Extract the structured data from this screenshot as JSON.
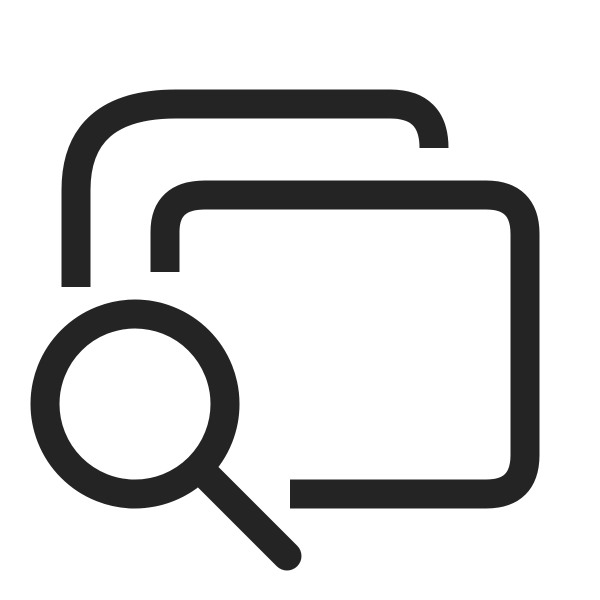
{
  "icon": {
    "name": "search-multiple-windows-icon",
    "stroke_color": "#242424",
    "background_color": "#ffffff"
  }
}
